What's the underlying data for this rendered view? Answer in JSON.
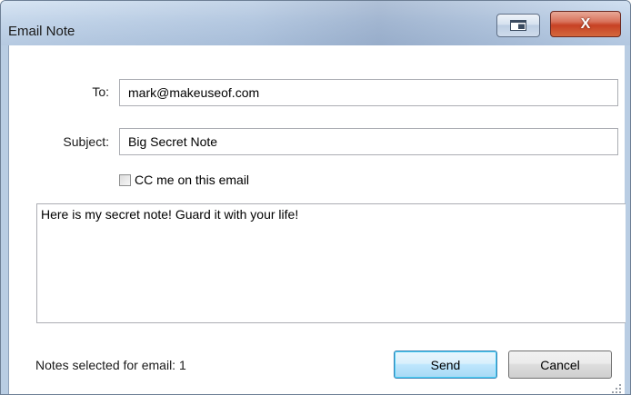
{
  "window": {
    "title": "Email Note"
  },
  "titlebar": {
    "restore_icon": "restore-window-icon",
    "close_label": "X"
  },
  "form": {
    "to_label": "To:",
    "to_value": "mark@makeuseof.com",
    "subject_label": "Subject:",
    "subject_value": "Big Secret Note",
    "cc_label": "CC me on this email",
    "cc_checked": false,
    "body_value": "Here is my secret note! Guard it with your life!"
  },
  "footer": {
    "status": "Notes selected for email: 1",
    "send_label": "Send",
    "cancel_label": "Cancel"
  },
  "colors": {
    "close_button": "#c74124",
    "default_button_border": "#3c7fb1",
    "field_border": "#abadb3"
  }
}
